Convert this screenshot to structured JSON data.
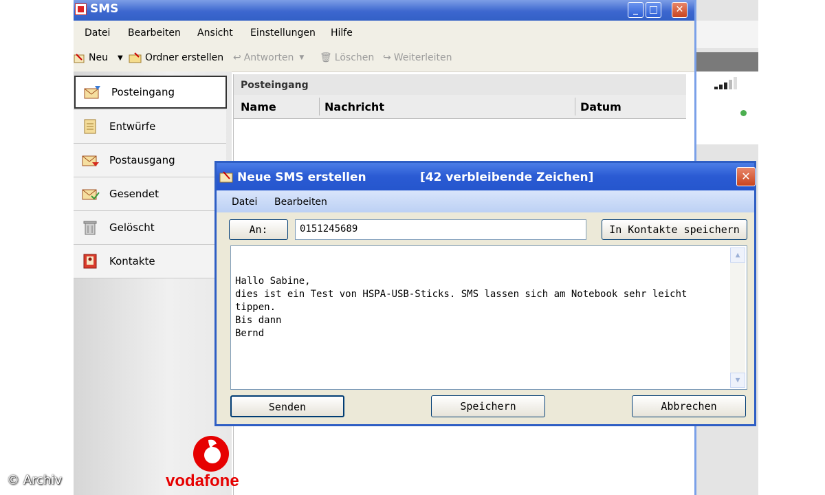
{
  "main_window": {
    "title": "SMS",
    "menu": [
      "Datei",
      "Bearbeiten",
      "Ansicht",
      "Einstellungen",
      "Hilfe"
    ],
    "toolbar": {
      "neu": "Neu",
      "ordner_erstellen": "Ordner erstellen",
      "antworten": "Antworten",
      "loeschen": "Löschen",
      "weiterleiten": "Weiterleiten"
    }
  },
  "sidebar": {
    "items": [
      {
        "label": "Posteingang",
        "icon": "inbox-icon",
        "selected": true
      },
      {
        "label": "Entwürfe",
        "icon": "drafts-icon"
      },
      {
        "label": "Postausgang",
        "icon": "outbox-icon"
      },
      {
        "label": "Gesendet",
        "icon": "sent-icon"
      },
      {
        "label": "Gelöscht",
        "icon": "trash-icon"
      },
      {
        "label": "Kontakte",
        "icon": "contacts-icon"
      }
    ]
  },
  "list": {
    "header": "Posteingang",
    "columns": [
      "Name",
      "Nachricht",
      "Datum"
    ]
  },
  "dialog": {
    "title": "Neue SMS erstellen",
    "remaining": "[42 verbleibende Zeichen]",
    "menu": [
      "Datei",
      "Bearbeiten"
    ],
    "to_label": "An:",
    "to_value": "0151245689",
    "save_contact": "In Kontakte speichern",
    "message": "Hallo Sabine,\ndies ist ein Test von HSPA-USB-Sticks. SMS lassen sich am Notebook sehr leicht\ntippen.\nBis dann\nBernd",
    "send": "Senden",
    "save": "Speichern",
    "cancel": "Abbrechen"
  },
  "brand": {
    "name": "vodafone",
    "color": "#e60000"
  },
  "watermark": "© Archiv",
  "colors": {
    "titlebar": "#3260c6",
    "dialog_border": "#2e5ec4",
    "signal": "#4caf50"
  }
}
